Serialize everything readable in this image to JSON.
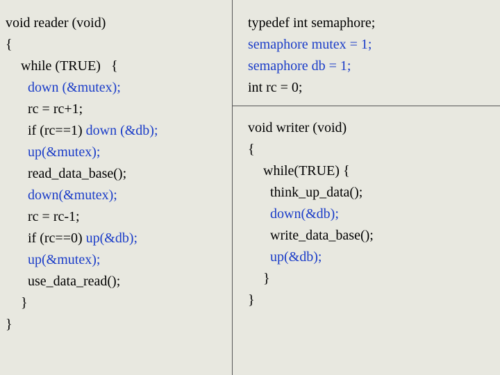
{
  "left": {
    "l1_a": "void reader (void)",
    "l2": "{",
    "l3": "while (TRUE)   {",
    "l4": "down (&mutex);",
    "l5": "rc = rc+1;",
    "l6_a": "if (rc==1) ",
    "l6_b": "down (&db);",
    "l7": "up(&mutex);",
    "l8": "read_data_base();",
    "l9": "down(&mutex);",
    "l10": "rc = rc-1;",
    "l11_a": "if (rc==0) ",
    "l11_b": "up(&db);",
    "l12": "up(&mutex);",
    "l13": "use_data_read();",
    "l14": "}",
    "l15": "}"
  },
  "decl": {
    "d1": "typedef int semaphore;",
    "d2": "semaphore mutex = 1;",
    "d3": "semaphore db = 1;",
    "d4": "int rc = 0;"
  },
  "writer": {
    "w1": "void writer (void)",
    "w2": "{",
    "w3": "while(TRUE) {",
    "w4": "think_up_data();",
    "w5": "down(&db);",
    "w6": "write_data_base();",
    "w7": "up(&db);",
    "w8": "}",
    "w9": "}"
  }
}
